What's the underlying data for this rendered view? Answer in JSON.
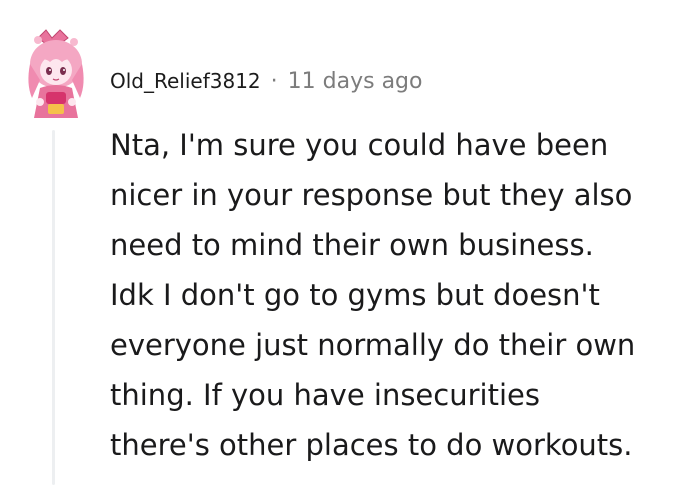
{
  "comment": {
    "username": "Old_Relief3812",
    "separator": "·",
    "timestamp": "11 days ago",
    "avatar_icon": "anime-girl-avatar-icon",
    "body_lines": [
      "Nta, I'm sure you could have been",
      "nicer in your response but they also",
      "need to mind their own business.",
      "Idk I don't go to gyms but doesn't",
      "everyone just normally do their own",
      "thing. If you have insecurities",
      "there's other places to do workouts."
    ]
  },
  "colors": {
    "username": "#1c1c1c",
    "meta": "#7c7c7c",
    "body_text": "#1a1a1b",
    "thread_line": "#edeff1",
    "avatar_pink": "#f4a7c3",
    "avatar_red": "#d6336c"
  }
}
